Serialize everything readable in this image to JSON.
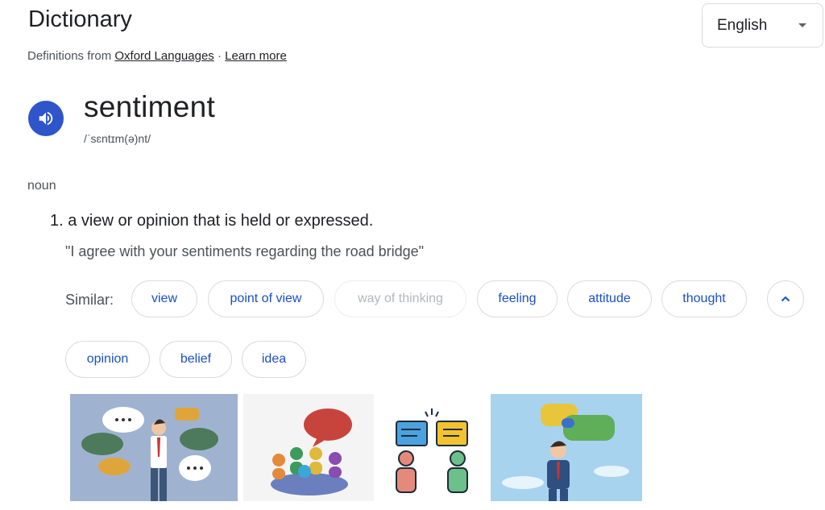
{
  "header": {
    "title": "Dictionary",
    "source_prefix": "Definitions from ",
    "source_link": "Oxford Languages",
    "separator": " · ",
    "learn_more": "Learn more",
    "language": "English"
  },
  "entry": {
    "word": "sentiment",
    "phonetic": "/ˈsɛntɪm(ə)nt/",
    "part_of_speech": "noun",
    "definition": "1. a view or opinion that is held or expressed.",
    "example": "\"I agree with your sentiments regarding the road bridge\"",
    "similar_label": "Similar:",
    "similar": [
      "view",
      "point of view",
      "way of thinking",
      "feeling",
      "attitude",
      "thought",
      "opinion",
      "belief",
      "idea"
    ]
  },
  "icons": {
    "speaker": "speaker-icon",
    "dropdown": "chevron-down-icon",
    "collapse": "chevron-up-icon"
  },
  "colors": {
    "accent": "#2e55c9",
    "chip_text": "#1a4fc4",
    "muted_chip_text": "#b3b7bc"
  }
}
